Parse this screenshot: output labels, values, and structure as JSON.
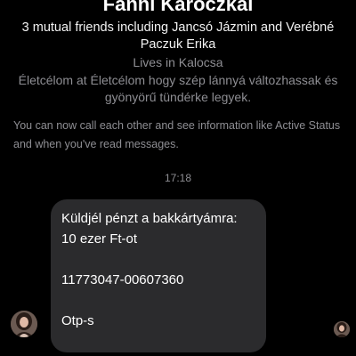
{
  "profile": {
    "name": "Fanni Karóczkai",
    "mutual_friends": "3 mutual friends including Jancsó Jázmin and Verébné Paczuk Erika",
    "location": "Lives in Kalocsa",
    "bio": "Életcélom at Életcélom hogy szép lánnyá változhassak és gyönyörű tündérke legyek."
  },
  "notice": "You can now call each other and see information like Active Status and when you've read messages.",
  "conversation": {
    "timestamp": "17:18",
    "message_lines": [
      "Küldjél pénzt a bakkártyámra:",
      "10 ezer Ft-ot",
      "",
      "11773047-00607360",
      "",
      "Otp-s"
    ]
  },
  "colors": {
    "background": "#000000",
    "bubble": "#2b2b2d",
    "secondary_text": "#8e8e93"
  }
}
